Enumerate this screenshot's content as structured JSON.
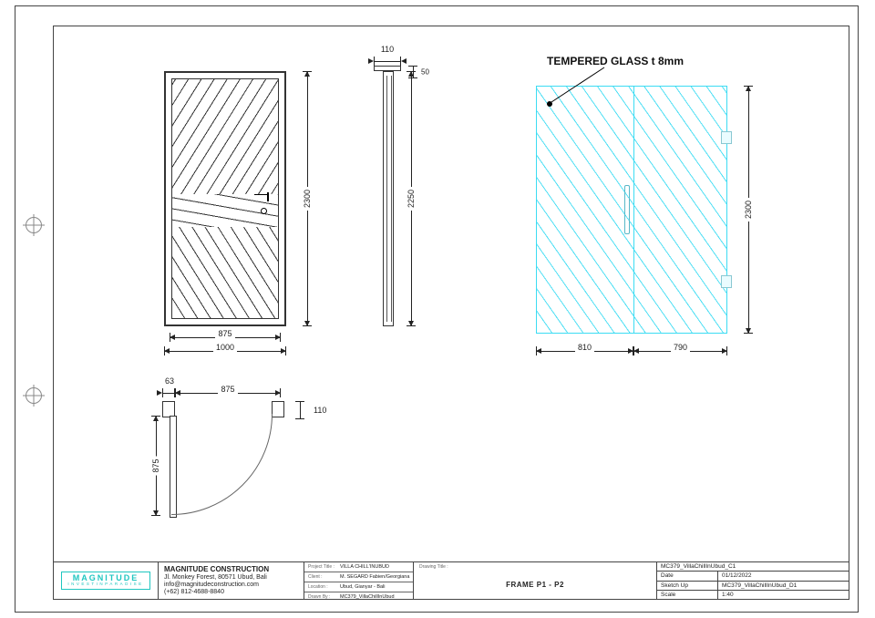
{
  "annotations": {
    "tempered_glass_note": "TEMPERED GLASS t 8mm"
  },
  "door_front": {
    "dims": {
      "height_mm": "2300",
      "leaf_width_mm": "875",
      "overall_width_mm": "1000"
    }
  },
  "door_side": {
    "dims": {
      "cap_width_mm": "110",
      "cap_depth_mm": "50",
      "height_mm": "2250"
    }
  },
  "door_plan": {
    "dims": {
      "jamb_mm": "63",
      "leaf_mm": "875",
      "depth_mm": "110",
      "swing_radius_mm": "875"
    }
  },
  "glass_panel": {
    "dims": {
      "height_mm": "2300",
      "left_leaf_mm": "810",
      "right_leaf_mm": "790"
    }
  },
  "titleblock": {
    "logo": {
      "name": "MAGNITUDE",
      "tagline": "INVESTINPARADISE"
    },
    "company": {
      "name": "MAGNITUDE CONSTRUCTION",
      "addr": "Jl. Monkey Forest, 80571 Ubud, Bali",
      "email": "info@magnitudeconstruction.com",
      "phone": "(+62) 812-4688-8840"
    },
    "project": {
      "title_key": "Project Title :",
      "title_val": "VILLA CHILL'INUBUD",
      "client_key": "Client :",
      "client_val": "M. SEGARD Fabien/Georgiana",
      "location_key": "Location :",
      "location_val": "Ubud, Gianyar - Bali",
      "drawnby_key": "Drawn By :",
      "drawnby_val": "MC379_VillaChillInUbud"
    },
    "drawing": {
      "header": "Drawing Title :",
      "title": "FRAME P1 - P2"
    },
    "rev": {
      "file": "MC379_VillaChillInUbud_C1",
      "date_key": "Date",
      "date_val": "01/12/2022",
      "sketch_key": "Sketch Up",
      "sketch_val": "MC379_VillaChillInUbud_D1",
      "scale_key": "Scale",
      "scale_val": "1:40"
    }
  }
}
